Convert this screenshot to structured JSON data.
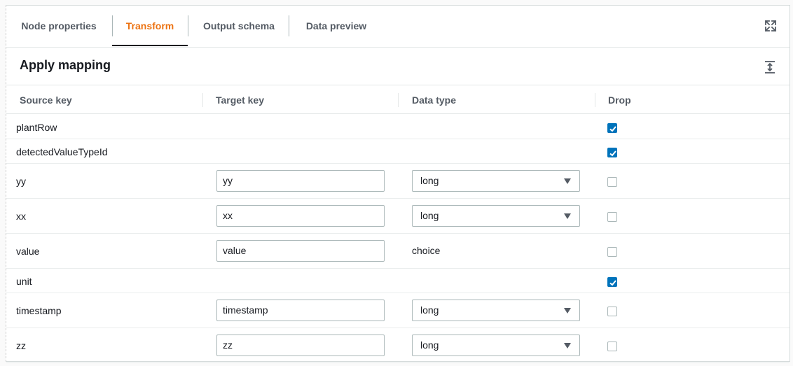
{
  "tabs": [
    {
      "label": "Node properties"
    },
    {
      "label": "Transform"
    },
    {
      "label": "Output schema"
    },
    {
      "label": "Data preview"
    }
  ],
  "active_tab": "Transform",
  "section": {
    "title": "Apply mapping"
  },
  "columns": {
    "source_key": "Source key",
    "target_key": "Target key",
    "data_type": "Data type",
    "drop": "Drop"
  },
  "rows": [
    {
      "source": "plantRow",
      "target": "",
      "type": "",
      "drop": true
    },
    {
      "source": "detectedValueTypeId",
      "target": "",
      "type": "",
      "drop": true
    },
    {
      "source": "yy",
      "target": "yy",
      "type": "long",
      "drop": false
    },
    {
      "source": "xx",
      "target": "xx",
      "type": "long",
      "drop": false
    },
    {
      "source": "value",
      "target": "value",
      "type": "choice",
      "drop": false
    },
    {
      "source": "unit",
      "target": "",
      "type": "",
      "drop": true
    },
    {
      "source": "timestamp",
      "target": "timestamp",
      "type": "long",
      "drop": false
    },
    {
      "source": "zz",
      "target": "zz",
      "type": "long",
      "drop": false
    }
  ],
  "colors": {
    "accent": "#ec7211",
    "checkbox": "#0073bb"
  }
}
